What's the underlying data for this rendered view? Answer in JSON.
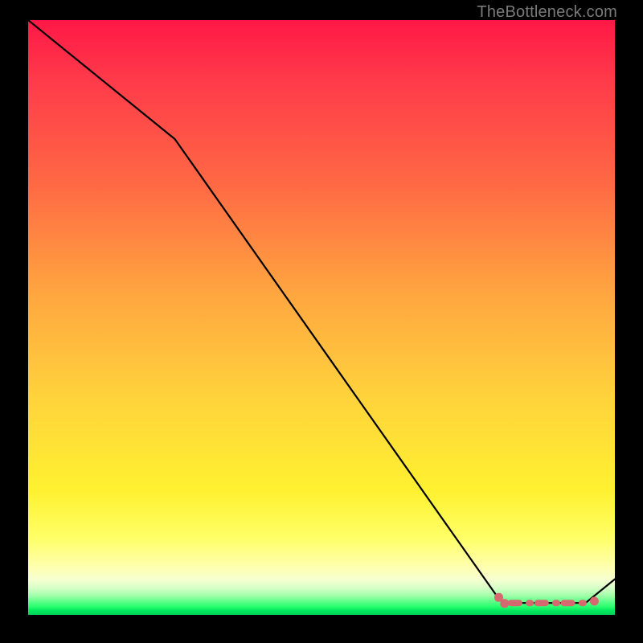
{
  "watermark": "TheBottleneck.com",
  "chart_data": {
    "type": "line",
    "title": "",
    "xlabel": "",
    "ylabel": "",
    "xlim": [
      0,
      100
    ],
    "ylim": [
      0,
      100
    ],
    "series": [
      {
        "name": "curve",
        "x": [
          0,
          25,
          80,
          81,
          95,
          100
        ],
        "y": [
          100,
          80,
          3,
          2,
          2,
          6
        ]
      }
    ],
    "markers": [
      {
        "shape": "round",
        "x": 80,
        "y": 3,
        "color": "#d6696f"
      },
      {
        "shape": "round",
        "x": 81,
        "y": 2,
        "color": "#d6696f"
      },
      {
        "shape": "dash-long",
        "x": 83,
        "y": 2,
        "color": "#d6696f"
      },
      {
        "shape": "dash-short",
        "x": 85.5,
        "y": 2,
        "color": "#d6696f"
      },
      {
        "shape": "dash-long",
        "x": 87.5,
        "y": 2,
        "color": "#d6696f"
      },
      {
        "shape": "dash-short",
        "x": 90,
        "y": 2,
        "color": "#d6696f"
      },
      {
        "shape": "dash-long",
        "x": 92,
        "y": 2,
        "color": "#d6696f"
      },
      {
        "shape": "dash-short",
        "x": 94.5,
        "y": 2,
        "color": "#d6696f"
      },
      {
        "shape": "dot",
        "x": 96.5,
        "y": 2.3,
        "color": "#d6696f"
      }
    ],
    "line_color": "#000000",
    "marker_color": "#d6696f",
    "grid": false
  }
}
